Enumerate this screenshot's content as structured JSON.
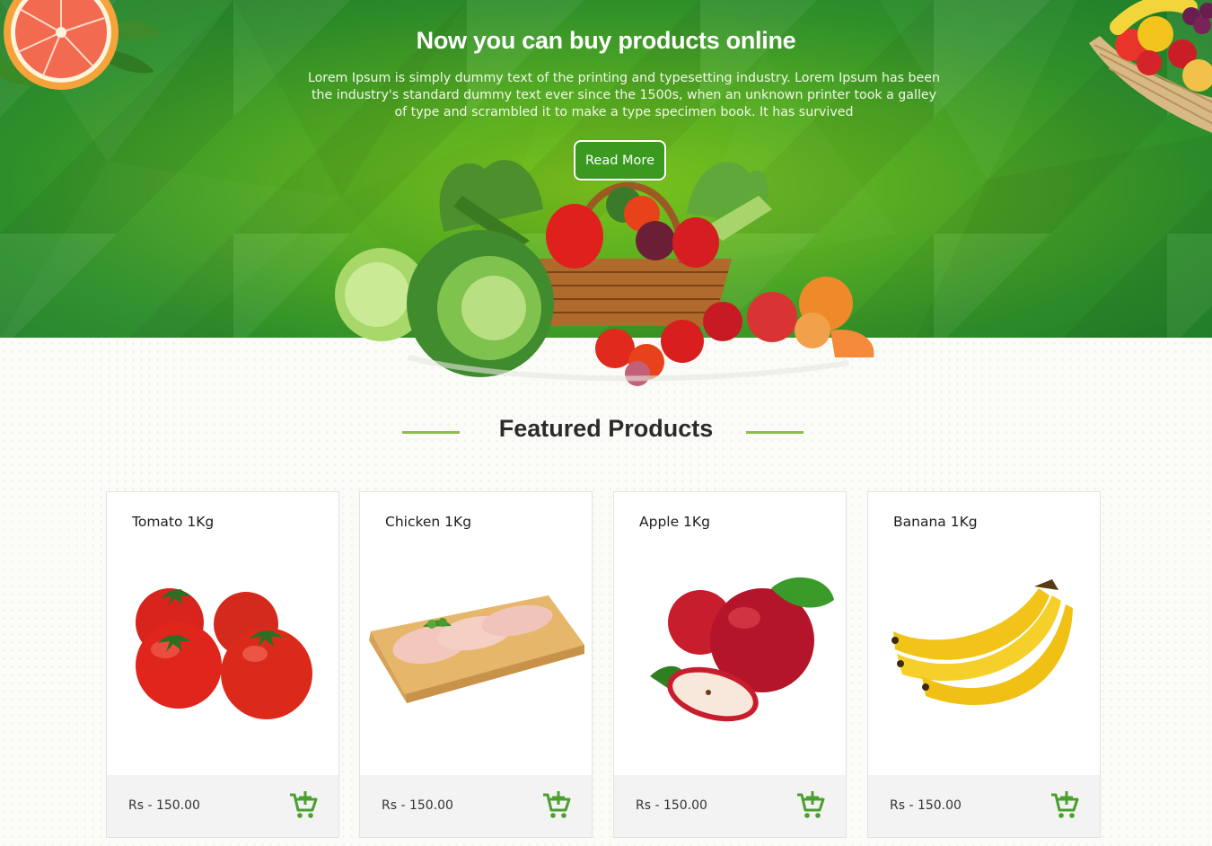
{
  "hero": {
    "title": "Now you can buy products online",
    "description": "Lorem Ipsum is simply dummy text of the printing and typesetting industry. Lorem Ipsum has been the industry's standard dummy text ever since the 1500s, when an unknown printer took a galley of type and scrambled it to make a type specimen book. It has survived",
    "read_more_label": "Read More"
  },
  "featured": {
    "title": "Featured Products"
  },
  "products": [
    {
      "name": "Tomato 1Kg",
      "price": "Rs - 150.00",
      "icon": "tomato-image"
    },
    {
      "name": "Chicken 1Kg",
      "price": "Rs - 150.00",
      "icon": "chicken-image"
    },
    {
      "name": "Apple 1Kg",
      "price": "Rs - 150.00",
      "icon": "apple-image"
    },
    {
      "name": "Banana 1Kg",
      "price": "Rs - 150.00",
      "icon": "banana-image"
    }
  ],
  "colors": {
    "brand_green": "#3a9a1f",
    "cart_icon": "#4aa02c",
    "accent_line": "#8bbf4a"
  }
}
